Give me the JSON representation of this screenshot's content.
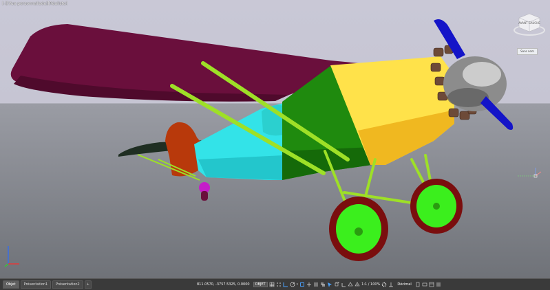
{
  "viewport": {
    "label": "[-][Vue personnalisée][Réaliste]",
    "viewcube_label": "AVANT GAUCHE",
    "projection_menu": "Sans nom"
  },
  "colors": {
    "wing": "#6a0f3c",
    "fuselage_front": "#ffe24a",
    "fuselage_mid": "#1f8a0e",
    "fuselage_rear": "#33e3e8",
    "tail": "#b8390b",
    "struts": "#9ee027",
    "wheel_tire": "#7a0e0e",
    "wheel_hub": "#3bef1d",
    "propeller": "#1414c8",
    "spinner": "#8c8c8c",
    "engine": "#6d4a38"
  },
  "statusbar": {
    "tabs": [
      {
        "label": "Objet",
        "active": true
      },
      {
        "label": "Présentation1",
        "active": false
      },
      {
        "label": "Présentation2",
        "active": false
      }
    ],
    "add_tab": "+",
    "coordinates": "811.0570, -3757.5325, 0.0000",
    "mode": "OBJET",
    "annotation_scale": "1:1 / 100%",
    "units": "Décimal",
    "icons": [
      "grid-icon",
      "snap-icon",
      "ortho-icon",
      "polar-icon",
      "osnap-icon",
      "otrack-icon",
      "lineweight-icon",
      "transparency-icon",
      "selection-cycling-icon",
      "3d-osnap-icon",
      "dynamic-ucs-icon",
      "annotation-visibility-icon",
      "autoscale-icon",
      "workspace-gear-icon",
      "isolate-objects-icon",
      "hardware-acceleration-icon",
      "clean-screen-icon",
      "customize-menu-icon"
    ]
  }
}
